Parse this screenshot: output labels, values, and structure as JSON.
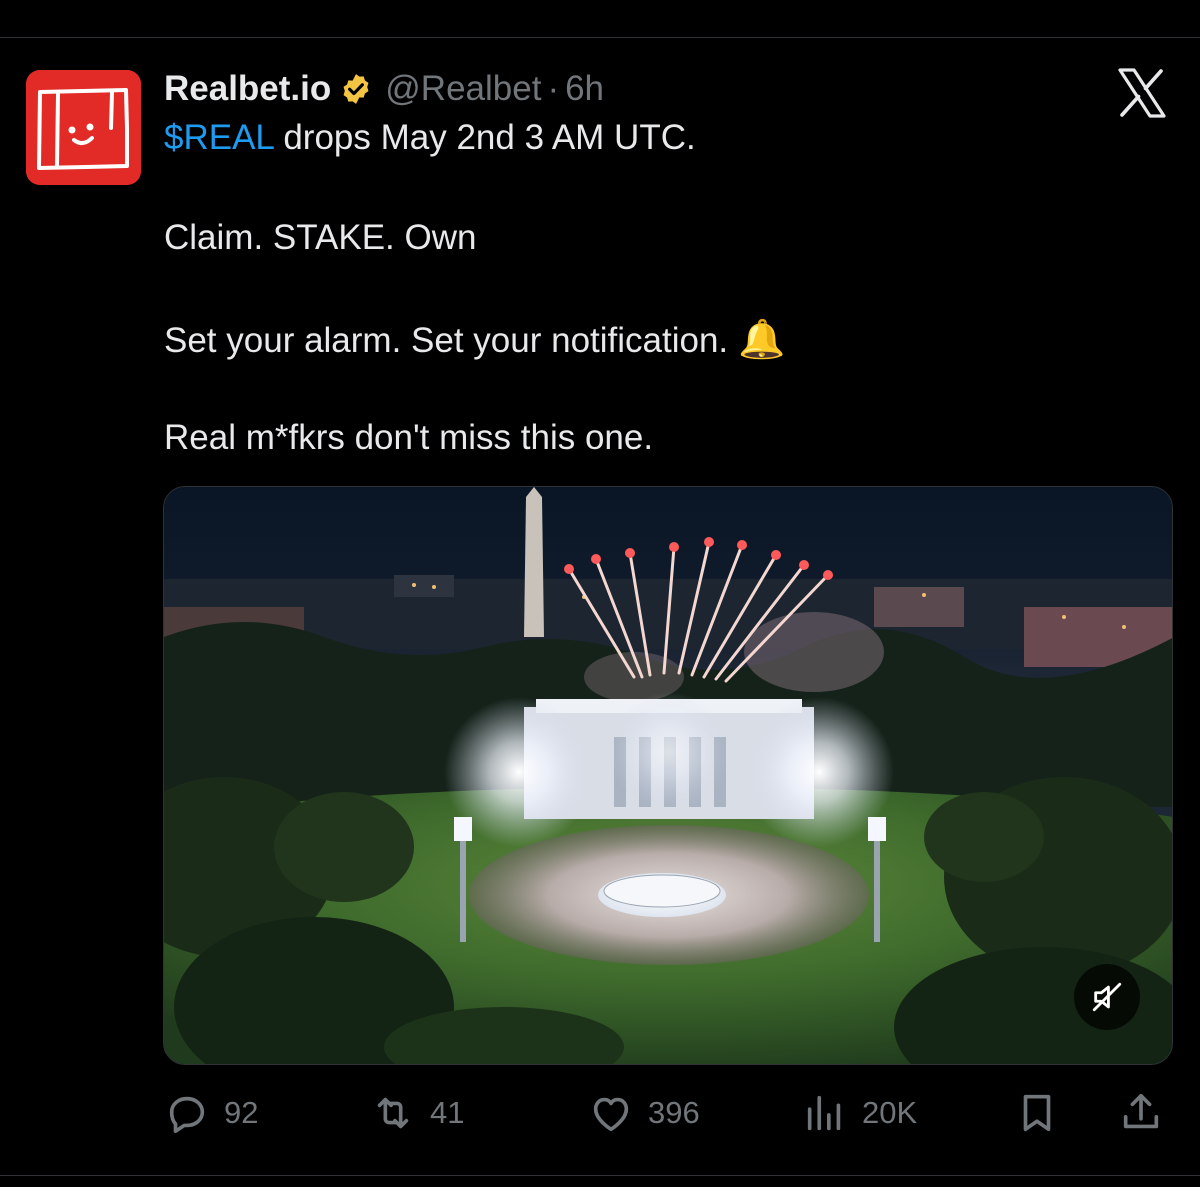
{
  "tweet": {
    "author": {
      "display_name": "Realbet.io",
      "verified": true,
      "verified_color": "#f4c542",
      "handle": "@Realbet",
      "separator": "·",
      "time": "6h",
      "avatar_color": "#e22a27"
    },
    "text": {
      "cashtag": "$REAL",
      "line1_rest": " drops May 2nd 3 AM UTC.",
      "line2": "Claim. STAKE. Own",
      "line3": "Set your alarm. Set your notification.",
      "line3_emoji": "🔔",
      "line4": "Real m*fkrs don't miss this one."
    },
    "cashtag_color": "#1d9bf0",
    "media": {
      "type": "video",
      "muted": true
    },
    "stats": {
      "replies": "92",
      "reposts": "41",
      "likes": "396",
      "views": "20K"
    }
  },
  "icons": {
    "platform": "x-logo-icon",
    "mute": "speaker-muted-icon",
    "reply": "reply-icon",
    "repost": "repost-icon",
    "like": "heart-icon",
    "views": "views-icon",
    "bookmark": "bookmark-icon",
    "share": "share-icon"
  },
  "colors": {
    "background": "#000000",
    "text": "#e7e9ea",
    "muted_text": "#71767b",
    "divider": "#2f3336"
  }
}
